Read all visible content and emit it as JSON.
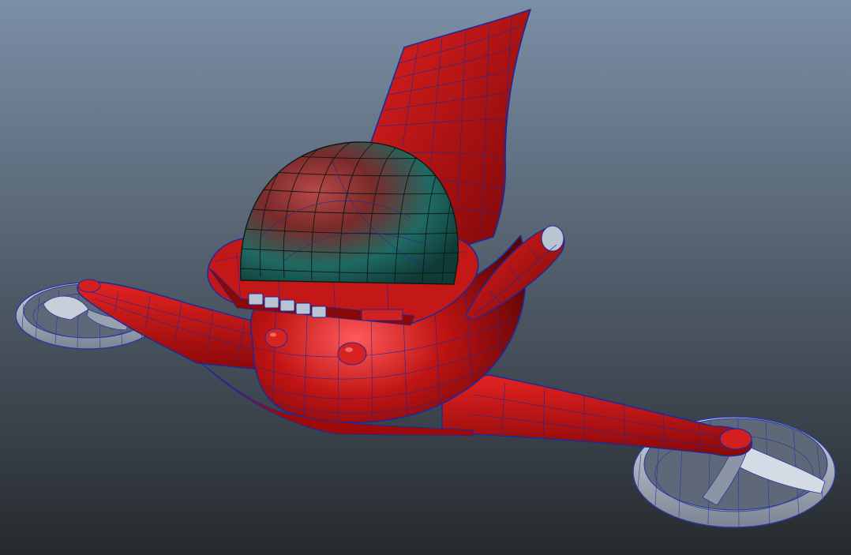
{
  "viewport": {
    "background_top": "#7b8fa6",
    "background_bottom": "#262a2e"
  },
  "model": {
    "body_color": "#c01414",
    "body_highlight": "#ff5a5a",
    "body_shadow": "#5c0404",
    "wire_color": "#1b2a9c",
    "canopy_color": "#1f6a63",
    "canopy_wire": "#0b1a14",
    "rotor_color": "#aeb6c4",
    "rotor_wire": "#2a3a9e",
    "panel_color": "#b9c3d2"
  }
}
